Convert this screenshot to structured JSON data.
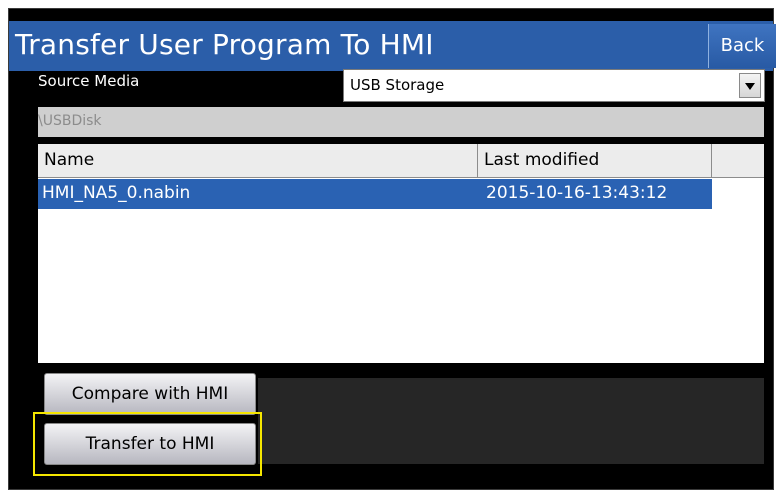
{
  "header": {
    "title": "Transfer User Program To HMI",
    "back_label": "Back"
  },
  "source": {
    "label": "Source Media",
    "selected": "USB Storage",
    "path": "\\USBDisk"
  },
  "file_table": {
    "columns": [
      "Name",
      "Last modified"
    ],
    "rows": [
      {
        "name": "HMI_NA5_0.nabin",
        "modified": "2015-10-16-13:43:12",
        "selected": true
      }
    ]
  },
  "actions": {
    "compare_label": "Compare with HMI",
    "transfer_label": "Transfer to HMI"
  },
  "colors": {
    "title_bar": "#2b5ea9",
    "selection": "#2a62b3",
    "highlight": "#f5e600",
    "background": "#000000"
  }
}
